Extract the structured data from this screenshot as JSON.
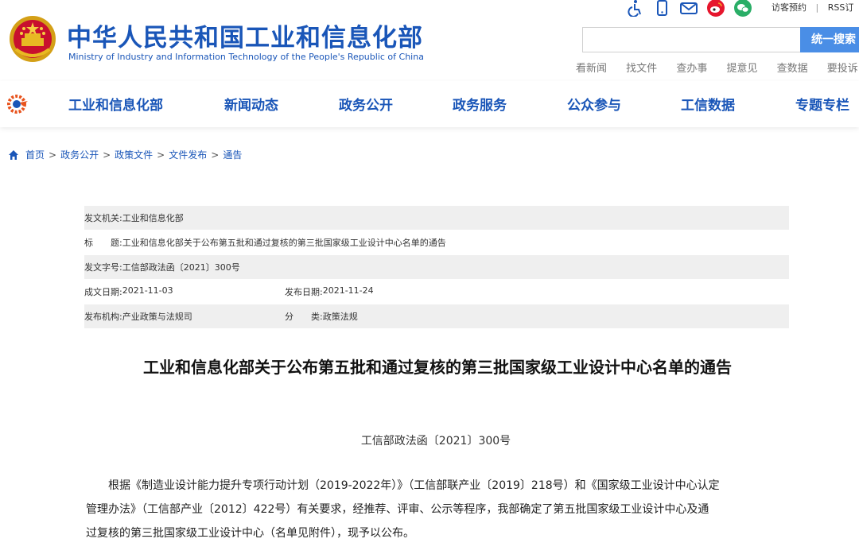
{
  "header": {
    "site_name_cn": "中华人民共和国工业和信息化部",
    "site_name_en": "Ministry of Industry and Information Technology of the People's Republic of China",
    "top_icons": [
      "accessibility-icon",
      "mobile-icon",
      "mail-icon",
      "weibo-icon",
      "wechat-icon"
    ],
    "visit_link": "访客预约",
    "separator": "|",
    "rss_link": "RSS订",
    "search_placeholder": "",
    "search_button": "统一搜索",
    "quick_links": [
      "看新闻",
      "找文件",
      "查办事",
      "提意见",
      "查数据",
      "要投诉"
    ],
    "brand_color": "#1a56b8",
    "button_color": "#4a8ee6"
  },
  "nav": {
    "items": [
      "工业和信息化部",
      "新闻动态",
      "政务公开",
      "政务服务",
      "公众参与",
      "工信数据",
      "专题专栏"
    ]
  },
  "breadcrumb": {
    "items": [
      "首页",
      "政务公开",
      "政策文件",
      "文件发布",
      "通告"
    ],
    "sep": ">"
  },
  "meta": {
    "issuer_label": "发文机关:",
    "issuer": "工业和信息化部",
    "title_label": "标　　题:",
    "title": "工业和信息化部关于公布第五批和通过复核的第三批国家级工业设计中心名单的通告",
    "docno_label": "发文字号:",
    "docno": "工信部政法函〔2021〕300号",
    "created_label": "成文日期:",
    "created": "2021-11-03",
    "published_label": "发布日期:",
    "published": "2021-11-24",
    "org_label": "发布机构:",
    "org": "产业政策与法规司",
    "category_label": "分　　类:",
    "category": "政策法规"
  },
  "article": {
    "title": "工业和信息化部关于公布第五批和通过复核的第三批国家级工业设计中心名单的通告",
    "number": "工信部政法函〔2021〕300号",
    "paragraph_lines": [
      "　　根据《制造业设计能力提升专项行动计划（2019-2022年）》（工信部联产业〔2019〕218号）和《国家级工业设计中心认定",
      "管理办法》（工信部产业〔2012〕422号）有关要求，经推荐、评审、公示等程序，我部确定了第五批国家级工业设计中心及通",
      "过复核的第三批国家级工业设计中心（名单见附件），现予以公布。"
    ]
  }
}
